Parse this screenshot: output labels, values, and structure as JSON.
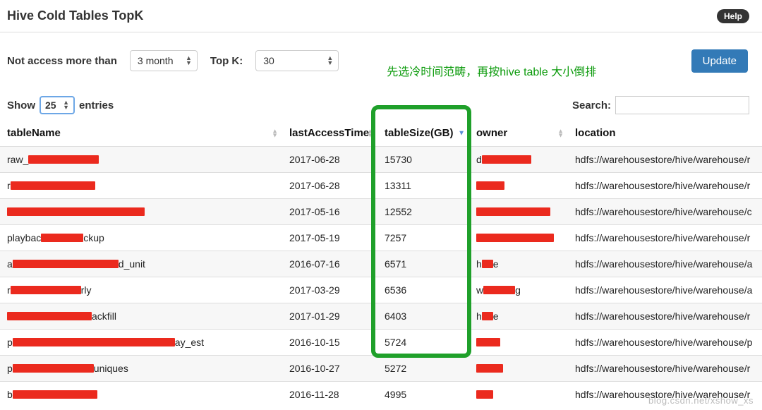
{
  "header": {
    "title": "Hive Cold Tables TopK",
    "help": "Help"
  },
  "controls": {
    "not_access_label": "Not access more than",
    "not_access_value": "3 month",
    "topk_label": "Top K:",
    "topk_value": "30",
    "annotation": "先选冷时间范畴，再按hive table 大小倒排",
    "update": "Update"
  },
  "toolbar": {
    "show_prefix": "Show",
    "show_value": "25",
    "show_suffix": "entries",
    "search_label": "Search:",
    "search_value": ""
  },
  "columns": {
    "tableName": "tableName",
    "lastAccessTime": "lastAccessTime",
    "tableSize": "tableSize(GB)",
    "owner": "owner",
    "location": "location"
  },
  "rows": [
    {
      "name_pre": "raw_",
      "redact_w": 100,
      "name_post": "",
      "last": "2017-06-28",
      "size": "15730",
      "own_pre": "d",
      "own_redact_w": 70,
      "own_post": "",
      "loc": "hdfs://warehousestore/hive/warehouse/r"
    },
    {
      "name_pre": "r",
      "redact_w": 120,
      "name_post": "",
      "last": "2017-06-28",
      "size": "13311",
      "own_pre": "",
      "own_redact_w": 40,
      "own_post": "",
      "loc": "hdfs://warehousestore/hive/warehouse/r"
    },
    {
      "name_pre": "",
      "redact_w": 195,
      "name_post": "",
      "last": "2017-05-16",
      "size": "12552",
      "own_pre": "",
      "own_redact_w": 105,
      "own_post": "",
      "loc": "hdfs://warehousestore/hive/warehouse/c"
    },
    {
      "name_pre": "playbac",
      "redact_w": 60,
      "name_post": "ckup",
      "last": "2017-05-19",
      "size": "7257",
      "own_pre": "",
      "own_redact_w": 110,
      "own_post": "",
      "loc": "hdfs://warehousestore/hive/warehouse/r"
    },
    {
      "name_pre": "a",
      "redact_w": 150,
      "name_post": "d_unit",
      "last": "2016-07-16",
      "size": "6571",
      "own_pre": "h",
      "own_redact_w": 16,
      "own_post": "e",
      "loc": "hdfs://warehousestore/hive/warehouse/a"
    },
    {
      "name_pre": "r",
      "redact_w": 100,
      "name_post": "rly",
      "last": "2017-03-29",
      "size": "6536",
      "own_pre": "w",
      "own_redact_w": 45,
      "own_post": "g",
      "loc": "hdfs://warehousestore/hive/warehouse/a"
    },
    {
      "name_pre": "",
      "redact_w": 120,
      "name_post": "ackfill",
      "last": "2017-01-29",
      "size": "6403",
      "own_pre": "h",
      "own_redact_w": 16,
      "own_post": "e",
      "loc": "hdfs://warehousestore/hive/warehouse/r"
    },
    {
      "name_pre": "p",
      "redact_w": 230,
      "name_post": "ay_est",
      "last": "2016-10-15",
      "size": "5724",
      "own_pre": "",
      "own_redact_w": 34,
      "own_post": "",
      "loc": "hdfs://warehousestore/hive/warehouse/p"
    },
    {
      "name_pre": "p",
      "redact_w": 115,
      "name_post": "uniques",
      "last": "2016-10-27",
      "size": "5272",
      "own_pre": "",
      "own_redact_w": 38,
      "own_post": "",
      "loc": "hdfs://warehousestore/hive/warehouse/r"
    },
    {
      "name_pre": "b",
      "redact_w": 120,
      "name_post": "",
      "last": "2016-11-28",
      "size": "4995",
      "own_pre": "",
      "own_redact_w": 24,
      "own_post": "",
      "loc": "hdfs://warehousestore/hive/warehouse/r"
    }
  ],
  "watermark": "blog.csdn.net/xshow_xs"
}
